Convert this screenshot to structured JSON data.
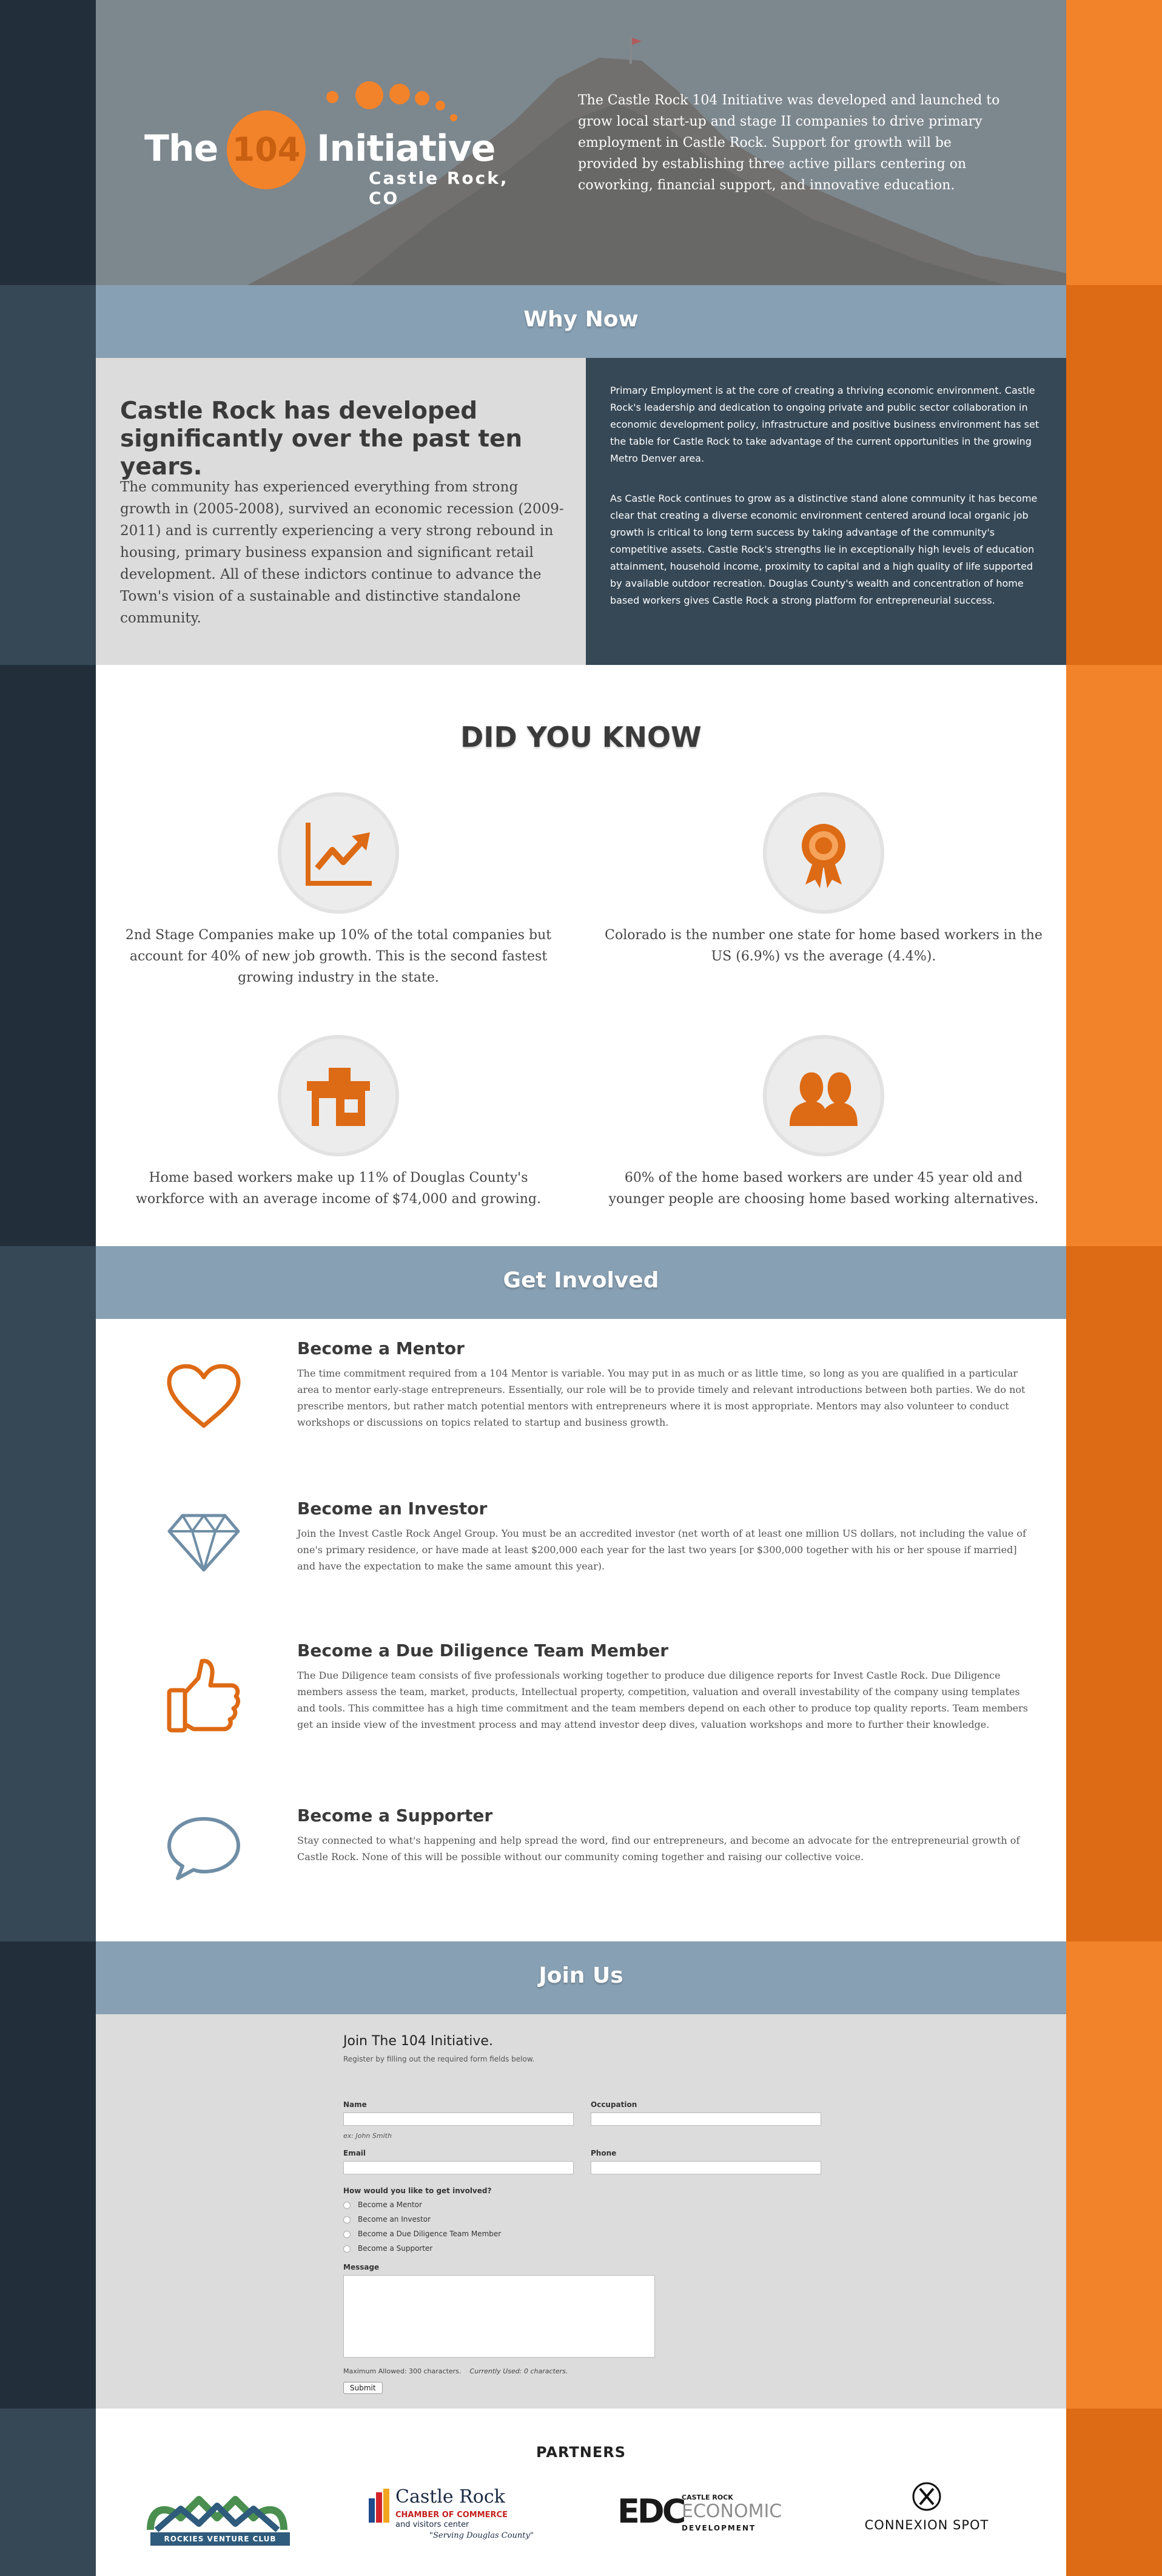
{
  "colors": {
    "orange": "#f2832a",
    "dark_orange": "#dd6a14",
    "steel_blue": "#88a0b3",
    "navy": "#364856",
    "dark_navy": "#222f3a",
    "light_gray": "#dcdcdc"
  },
  "hero": {
    "logo_the": "The",
    "logo_number": "104",
    "logo_initiative": "Initiative",
    "logo_location": "Castle Rock, CO",
    "intro": "The Castle Rock 104 Initiative was developed and launched to grow local start-up and stage II companies to drive primary employment in Castle Rock. Support for growth will be provided by establishing three active pillars centering on coworking, financial support, and innovative education."
  },
  "why_now": {
    "banner": "Why Now",
    "heading": "Castle Rock has developed significantly over the past ten years.",
    "body": "The community has experienced everything from strong growth in (2005-2008), survived an economic recession (2009-2011) and is currently experiencing a very strong rebound in housing, primary business expansion and significant retail development. All of these indictors continue to advance the Town's vision of a sustainable and distinctive standalone community.",
    "right_p1": "Primary Employment is at the core of creating a thriving economic environment. Castle Rock's leadership and dedication to ongoing private and public sector collaboration in economic development policy, infrastructure and positive business environment has set the table for Castle Rock to take advantage of the current opportunities in the growing Metro Denver area.",
    "right_p2": "As Castle Rock continues to grow as a distinctive stand alone community it has become clear that creating a diverse economic environment centered around local organic job growth is critical to long term success by taking advantage of the community's competitive assets. Castle Rock's strengths lie in exceptionally high levels of education attainment, household income, proximity to capital and a high quality of life supported by available outdoor recreation. Douglas County's wealth and concentration of home based workers gives Castle Rock a strong platform for entrepreneurial success."
  },
  "did_you_know": {
    "title": "DID YOU KNOW",
    "facts": [
      {
        "icon": "growth-chart-icon",
        "text": "2nd Stage Companies make up 10% of the total companies but account for 40% of new job growth. This is the second fastest growing industry in the state."
      },
      {
        "icon": "award-ribbon-icon",
        "text": "Colorado is the number one state for home based workers in the US (6.9%) vs the average (4.4%)."
      },
      {
        "icon": "house-icon",
        "text": "Home based workers make up 11% of Douglas County's workforce with an average income of $74,000 and growing."
      },
      {
        "icon": "people-icon",
        "text": "60% of the home based workers are under 45 year old and younger people are choosing home based working alternatives."
      }
    ]
  },
  "get_involved": {
    "banner": "Get Involved",
    "items": [
      {
        "icon": "heart-icon",
        "title": "Become a Mentor",
        "body": "The time commitment required from a 104 Mentor is variable. You may put in as much or as little time, so long as you are qualified in a particular area to mentor early-stage entrepreneurs. Essentially, our role will be to provide timely and relevant introductions between both parties. We do not prescribe mentors, but rather match potential mentors with entrepreneurs where it is most appropriate. Mentors may also volunteer to conduct workshops or discussions on topics related to startup and business growth."
      },
      {
        "icon": "diamond-icon",
        "title": "Become an Investor",
        "body": "Join the Invest Castle Rock Angel Group. You must be an accredited investor (net worth of at least one million US dollars, not including the value of one's primary residence, or have made at least $200,000 each year for the last two years [or $300,000 together with his or her spouse if married] and have the expectation to make the same amount this year)."
      },
      {
        "icon": "thumbs-up-icon",
        "title": "Become a Due Diligence Team Member",
        "body": "The Due Diligence team consists of five professionals working together to produce due diligence reports for Invest Castle Rock. Due Diligence members assess the team, market, products, Intellectual property, competition, valuation and overall investability of the company using templates and tools. This committee has a high time commitment and the team members depend on each other to produce top quality reports. Team members get an inside view of the investment process and may attend investor deep dives, valuation workshops and more to further their knowledge."
      },
      {
        "icon": "speech-bubble-icon",
        "title": "Become a Supporter",
        "body": "Stay connected to what's happening and help spread the word, find our entrepreneurs, and become an advocate for the entrepreneurial growth of Castle Rock. None of this will be possible without our community coming together and raising our collective voice."
      }
    ]
  },
  "join_us": {
    "banner": "Join Us",
    "form_title": "Join The 104 Initiative.",
    "form_subtitle": "Register by filling out the required form fields below.",
    "name_label": "Name",
    "name_hint": "ex: John Smith",
    "occupation_label": "Occupation",
    "email_label": "Email",
    "phone_label": "Phone",
    "involvement_label": "How would you like to get involved?",
    "options": [
      "Become a Mentor",
      "Become an Investor",
      "Become a Due Diligence Team Member",
      "Become a Supporter"
    ],
    "message_label": "Message",
    "max_allowed": "Maximum Allowed: 300 characters.",
    "currently_used": "Currently Used: 0 characters.",
    "submit": "Submit"
  },
  "partners": {
    "title": "PARTNERS",
    "rvc_text": "ROCKIES VENTURE CLUB",
    "chamber_name": "Castle Rock",
    "chamber_line1": "CHAMBER OF COMMERCE",
    "chamber_line2": "and visitors center",
    "chamber_tagline": "\"Serving Douglas County\"",
    "edc_letters": "EDC",
    "edc_top": "CASTLE ROCK",
    "edc_main": "ECONOMIC",
    "edc_bottom": "DEVELOPMENT",
    "connexion": "CONNEXION SPOT"
  }
}
